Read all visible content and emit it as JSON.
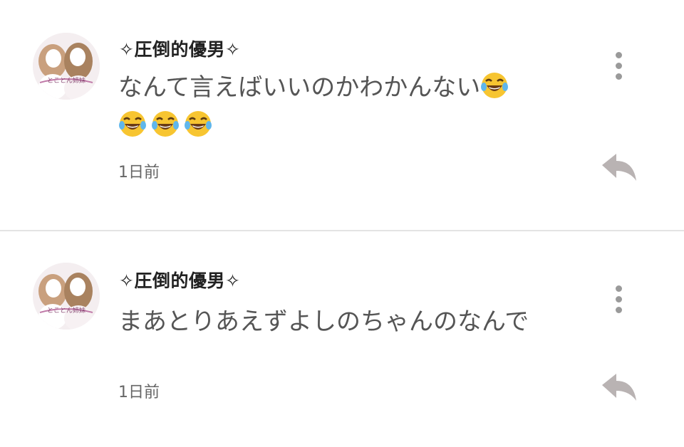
{
  "comments": [
    {
      "username": "✧圧倒的優男✧",
      "text_line1": "なんて言えばいいのかわかんない",
      "text_line1_emoji": "face-with-tears-of-joy-icon",
      "text_line2_emoji_count": 3,
      "timestamp": "1日前",
      "avatar_caption": "とことん姉妹"
    },
    {
      "username": "✧圧倒的優男✧",
      "text_line1": "まあとりあえずよしのちゃんのなんで",
      "timestamp": "1日前",
      "avatar_caption": "とことん姉妹"
    }
  ],
  "colors": {
    "icon_gray": "#9a9a9a",
    "reply_gray": "#b9b3b3",
    "divider": "#e3e3e3"
  }
}
